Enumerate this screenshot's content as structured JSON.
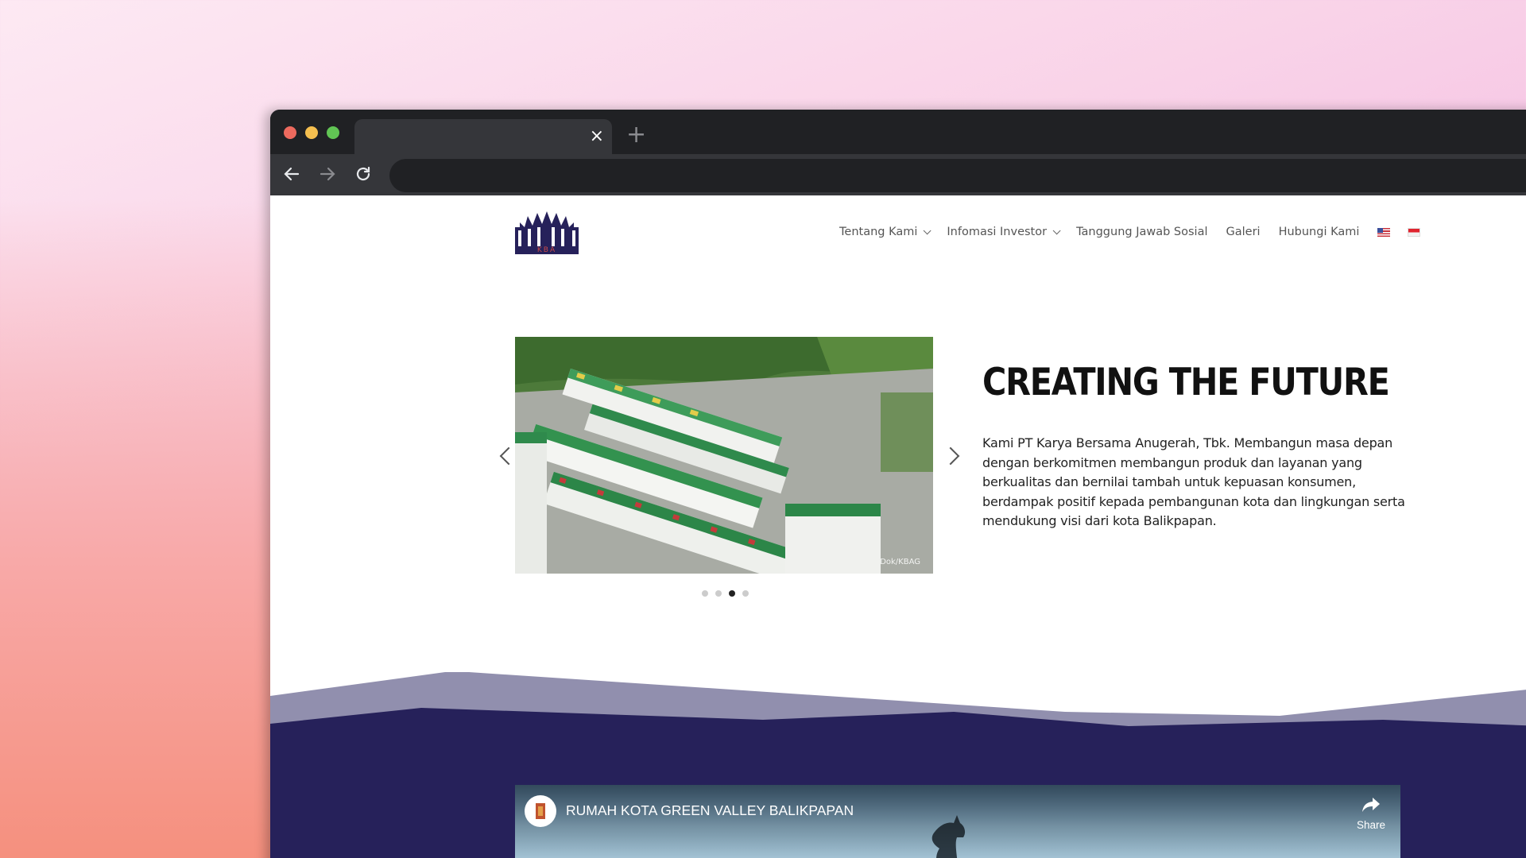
{
  "browser": {
    "tab_close_glyph": "×",
    "new_tab_glyph": "+"
  },
  "site": {
    "logo_text": "KBA",
    "nav": [
      {
        "label": "Tentang Kami",
        "dropdown": true
      },
      {
        "label": "Infomasi Investor",
        "dropdown": true
      },
      {
        "label": "Tanggung Jawab Sosial",
        "dropdown": false
      },
      {
        "label": "Galeri",
        "dropdown": false
      },
      {
        "label": "Hubungi Kami",
        "dropdown": false
      }
    ],
    "languages": [
      "en-US-flag",
      "id-flag"
    ]
  },
  "hero": {
    "title": "CREATING THE FUTURE",
    "text": "Kami PT Karya Bersama Anugerah, Tbk. Membangun masa depan dengan berkomitmen membangun produk dan layanan yang berkualitas dan bernilai tambah untuk kepuasan konsumen, berdampak positif kepada pembangunan kota dan lingkungan serta mendukung visi dari kota Balikpapan.",
    "photo_credit": "Dok/KBAG",
    "slides_total": 4,
    "active_slide": 3
  },
  "video": {
    "title": "RUMAH KOTA GREEN VALLEY BALIKPAPAN",
    "share_label": "Share"
  },
  "colors": {
    "brand_navy": "#26215a",
    "wave_light": "#918fae",
    "active_dot": "#222222"
  }
}
